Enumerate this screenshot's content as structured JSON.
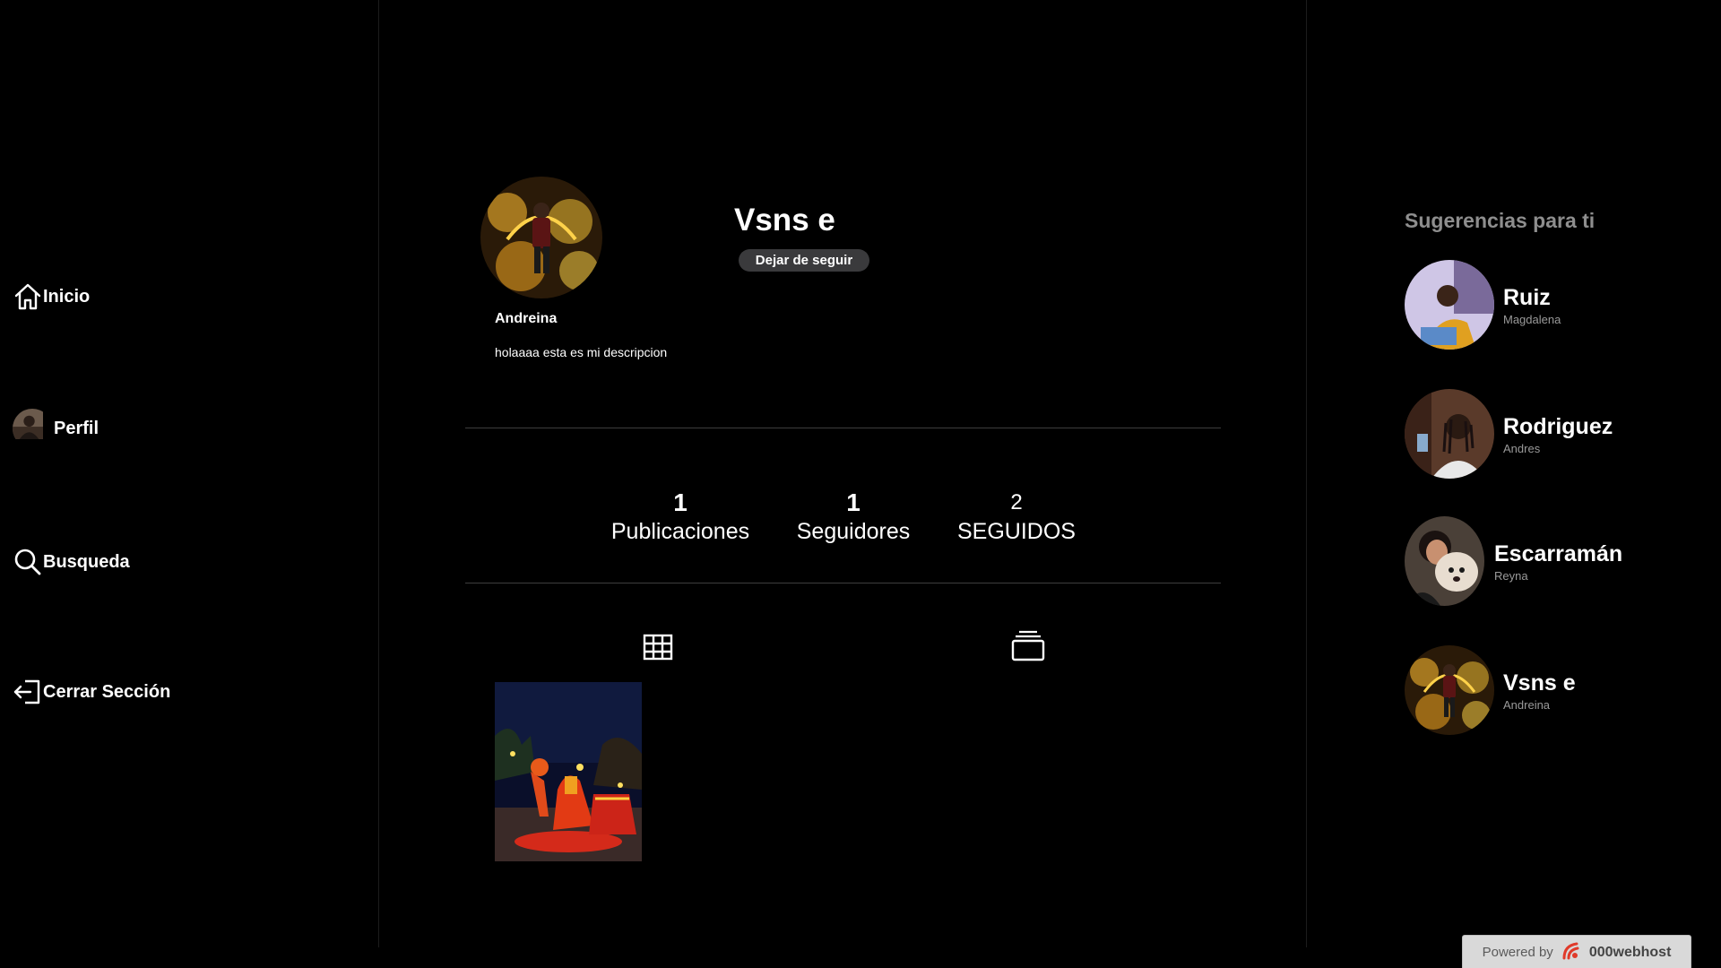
{
  "sidebar": {
    "items": [
      {
        "label": "Inicio",
        "icon": "home-icon"
      },
      {
        "label": "Perfil",
        "icon": "avatar"
      },
      {
        "label": "Busqueda",
        "icon": "search-icon"
      },
      {
        "label": "Cerrar Sección",
        "icon": "logout-icon"
      }
    ]
  },
  "profile": {
    "username": "Vsns e",
    "first_name": "Andreina",
    "description": "holaaaa esta es mi descripcion",
    "unfollow_label": "Dejar de seguir",
    "stats": [
      {
        "value": "1",
        "label": "Publicaciones"
      },
      {
        "value": "1",
        "label": "Seguidores"
      },
      {
        "value": "2",
        "label": "SEGUIDOS"
      }
    ]
  },
  "tabs": [
    {
      "icon": "grid-icon"
    },
    {
      "icon": "stack-icon"
    }
  ],
  "suggestions": {
    "title": "Sugerencias para ti",
    "items": [
      {
        "name": "Ruiz",
        "sub": "Magdalena"
      },
      {
        "name": "Rodriguez",
        "sub": "Andres"
      },
      {
        "name": "Escarramán",
        "sub": "Reyna"
      },
      {
        "name": "Vsns e",
        "sub": "Andreina"
      }
    ]
  },
  "footer": {
    "powered_by": "Powered by",
    "brand": "000webhost"
  },
  "colors": {
    "background": "#000000",
    "text": "#ffffff",
    "muted": "#8e8e8e",
    "button": "#3a3a3c"
  }
}
